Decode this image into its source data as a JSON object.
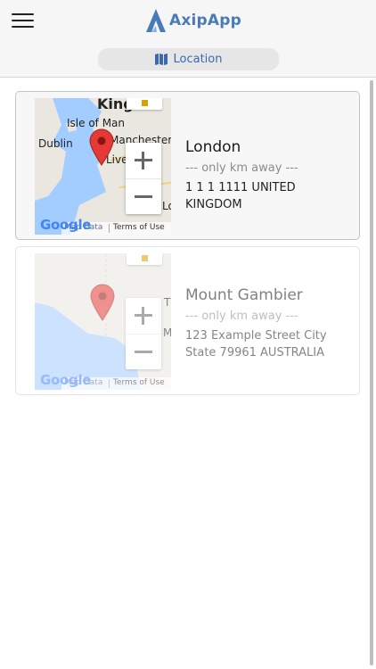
{
  "app": {
    "name": "AxipApp"
  },
  "header": {
    "menu_icon": "hamburger-icon",
    "location_label": "Location",
    "location_icon": "map-icon"
  },
  "colors": {
    "accent": "#3a6aab",
    "logo": "#4a7bb7",
    "marker": "#e53935",
    "water": "#a3ccff",
    "land": "#e9e7df"
  },
  "locations": [
    {
      "name": "London",
      "distance_text": "--- only km away ---",
      "address": "1 1 1 1111 UNITED KINGDOM",
      "map": {
        "labels": [
          "King",
          "Isle of Man",
          "Dublin",
          "Manchester",
          "Liverp",
          "Lo"
        ],
        "google": "Google",
        "map_data": "Map Data",
        "terms": "Terms of Use"
      }
    },
    {
      "name": "Mount Gambier",
      "distance_text": "--- only km away ---",
      "address": "123 Example Street City State 79961 AUSTRALIA",
      "map": {
        "labels": [
          "T",
          "M"
        ],
        "google": "Google",
        "map_data": "Map Data",
        "terms": "Terms of Use"
      }
    }
  ]
}
